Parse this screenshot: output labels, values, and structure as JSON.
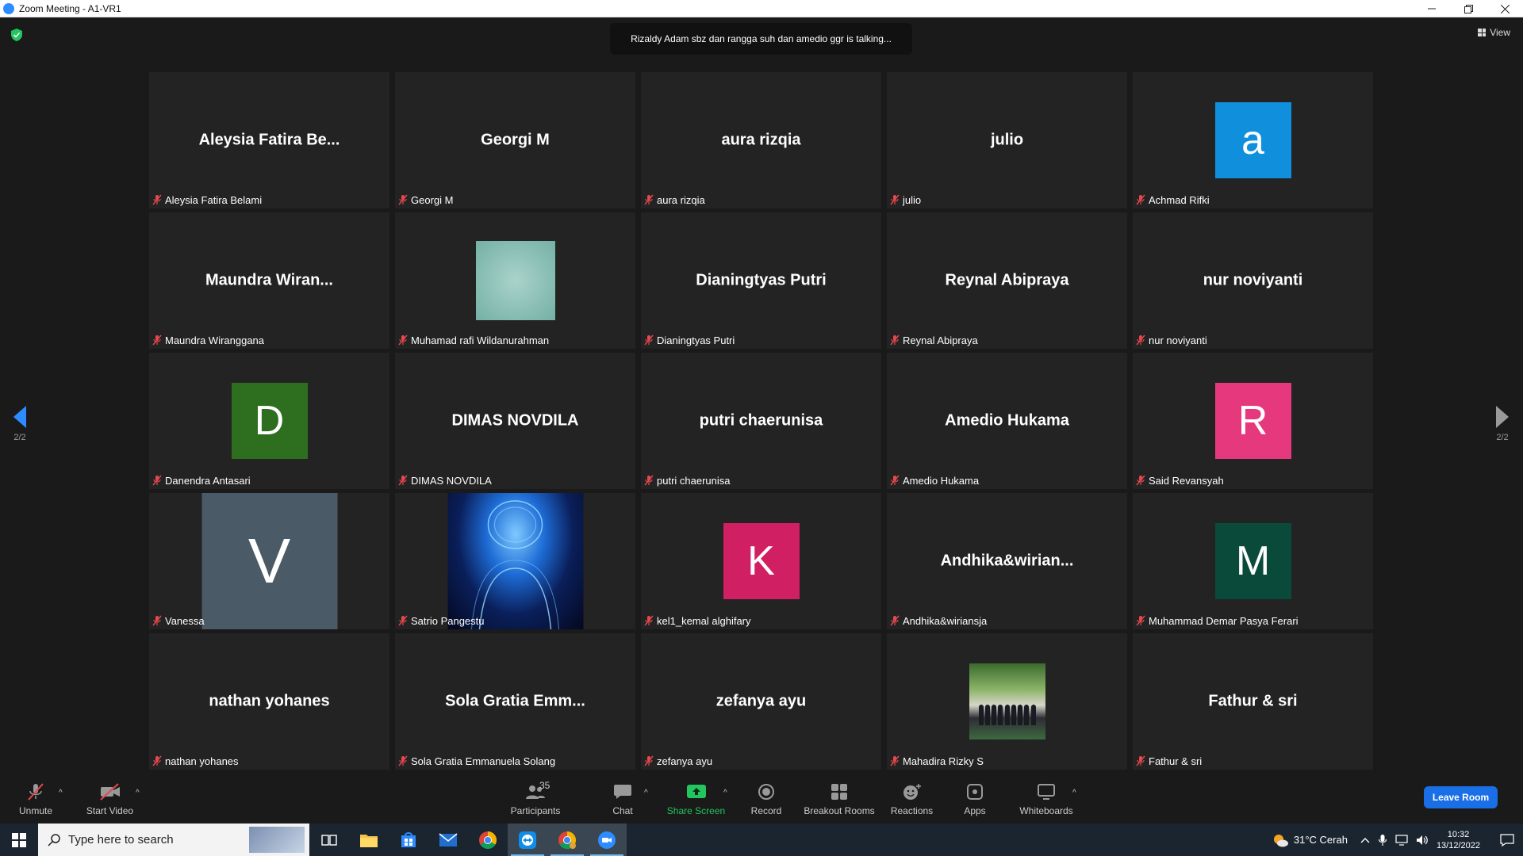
{
  "window": {
    "title": "Zoom Meeting - A1-VR1"
  },
  "meeting": {
    "talking_banner": "Rizaldy Adam sbz dan rangga suh dan amedio ggr is talking...",
    "view_label": "View",
    "page_left": "2/2",
    "page_right": "2/2"
  },
  "tiles": [
    {
      "center": "Aleysia  Fatira  Be...",
      "label": "Aleysia Fatira Belami"
    },
    {
      "center": "Georgi M",
      "label": "Georgi M"
    },
    {
      "center": "aura rizqia",
      "label": "aura rizqia"
    },
    {
      "center": "julio",
      "label": "julio"
    },
    {
      "avatar_letter": "a",
      "label": "Achmad Rifki"
    },
    {
      "center": "Maundra  Wiran...",
      "label": "Maundra Wiranggana"
    },
    {
      "label": "Muhamad rafi Wildanurahman"
    },
    {
      "center": "Dianingtyas Putri",
      "label": "Dianingtyas Putri"
    },
    {
      "center": "Reynal Abipraya",
      "label": "Reynal Abipraya"
    },
    {
      "center": "nur noviyanti",
      "label": "nur noviyanti"
    },
    {
      "avatar_letter": "D",
      "label": "Danendra Antasari"
    },
    {
      "center": "DIMAS NOVDILA",
      "label": "DIMAS NOVDILA"
    },
    {
      "center": "putri chaerunisa",
      "label": "putri chaerunisa"
    },
    {
      "center": "Amedio Hukama",
      "label": "Amedio Hukama"
    },
    {
      "avatar_letter": "R",
      "label": "Said Revansyah"
    },
    {
      "avatar_letter": "V",
      "label": "Vanessa"
    },
    {
      "label": "Satrio Pangestu"
    },
    {
      "avatar_letter": "K",
      "label": "kel1_kemal alghifary"
    },
    {
      "center": "Andhika&wirian...",
      "label": "Andhika&wiriansja"
    },
    {
      "avatar_letter": "M",
      "label": "Muhammad Demar Pasya Ferari"
    },
    {
      "center": "nathan yohanes",
      "label": "nathan yohanes"
    },
    {
      "center": "Sola  Gratia  Emm...",
      "label": "Sola Gratia Emmanuela Solang"
    },
    {
      "center": "zefanya ayu",
      "label": "zefanya ayu"
    },
    {
      "label": "Mahadira Rizky S"
    },
    {
      "center": "Fathur & sri",
      "label": "Fathur & sri"
    }
  ],
  "avatar_colors": {
    "a": "#0f8fdc",
    "D": "#2d6f1e",
    "R": "#e6397d",
    "V": "#4a5a66",
    "K": "#d11f63",
    "M": "#0a4a3a"
  },
  "toolbar": {
    "unmute": "Unmute",
    "start_video": "Start Video",
    "participants": "Participants",
    "participants_count": "35",
    "chat": "Chat",
    "share_screen": "Share Screen",
    "record": "Record",
    "breakout_rooms": "Breakout Rooms",
    "reactions": "Reactions",
    "apps": "Apps",
    "whiteboards": "Whiteboards",
    "leave_room": "Leave Room"
  },
  "taskbar": {
    "search_placeholder": "Type here to search",
    "weather": "31°C  Cerah",
    "time": "10:32",
    "date": "13/12/2022"
  },
  "colors": {
    "accent": "#2d8cff",
    "share_green": "#22c55e",
    "leave_blue": "#1a6fe6",
    "mic_off_red": "#e5484d"
  }
}
